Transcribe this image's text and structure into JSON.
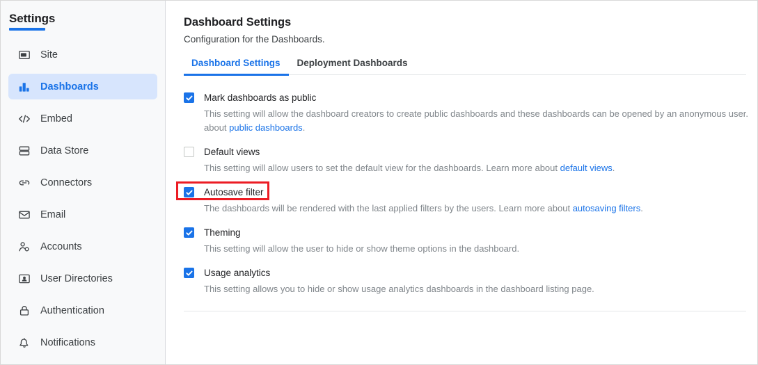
{
  "sidebar": {
    "title": "Settings",
    "items": [
      {
        "label": "Site",
        "icon": "url-box-icon",
        "active": false
      },
      {
        "label": "Dashboards",
        "icon": "bar-chart-icon",
        "active": true
      },
      {
        "label": "Embed",
        "icon": "code-brackets-icon",
        "active": false
      },
      {
        "label": "Data Store",
        "icon": "database-stack-icon",
        "active": false
      },
      {
        "label": "Connectors",
        "icon": "link-icon",
        "active": false
      },
      {
        "label": "Email",
        "icon": "envelope-icon",
        "active": false
      },
      {
        "label": "Accounts",
        "icon": "person-gear-icon",
        "active": false
      },
      {
        "label": "User Directories",
        "icon": "contact-card-icon",
        "active": false
      },
      {
        "label": "Authentication",
        "icon": "lock-icon",
        "active": false
      },
      {
        "label": "Notifications",
        "icon": "bell-icon",
        "active": false
      }
    ]
  },
  "main": {
    "title": "Dashboard Settings",
    "subtitle": "Configuration for the Dashboards.",
    "tabs": [
      {
        "label": "Dashboard Settings",
        "active": true
      },
      {
        "label": "Deployment Dashboards",
        "active": false
      }
    ],
    "settings": [
      {
        "label": "Mark dashboards as public",
        "checked": true,
        "desc_line1": "This setting will allow the dashboard creators to create public dashboards and these dashboards can be opened by an anonymous user.",
        "desc_line2_prefix": "about ",
        "desc_line2_link": "public dashboards",
        "desc_line2_suffix": ".",
        "highlighted": false
      },
      {
        "label": "Default views",
        "checked": false,
        "desc_prefix": "This setting will allow users to set the default view for the dashboards. Learn more about ",
        "desc_link": "default views",
        "desc_suffix": ".",
        "highlighted": false
      },
      {
        "label": "Autosave filter",
        "checked": true,
        "desc_prefix": "The dashboards will be rendered with the last applied filters by the users. Learn more about ",
        "desc_link": "autosaving filters",
        "desc_suffix": ".",
        "highlighted": true
      },
      {
        "label": "Theming",
        "checked": true,
        "desc_prefix": "This setting will allow the user to hide or show theme options in the dashboard.",
        "desc_link": "",
        "desc_suffix": "",
        "highlighted": false
      },
      {
        "label": "Usage analytics",
        "checked": true,
        "desc_prefix": "This setting allows you to hide or show usage analytics dashboards in the dashboard listing page.",
        "desc_link": "",
        "desc_suffix": "",
        "highlighted": false
      }
    ]
  },
  "colors": {
    "accent": "#1a73e8",
    "sidebar_active_bg": "#d7e5fd",
    "highlight_border": "#ec1c24",
    "muted_text": "#80868b"
  }
}
